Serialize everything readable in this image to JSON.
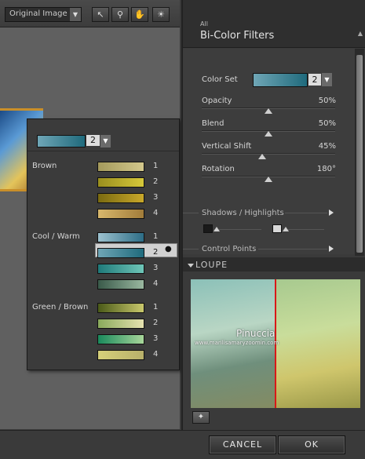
{
  "toolbar": {
    "view_mode": "Original Image",
    "tools": [
      "arrow-icon",
      "zoom-icon",
      "hand-icon",
      "light-icon"
    ]
  },
  "dropdown": {
    "selected_number": "2",
    "groups": [
      {
        "name": "Brown",
        "items": [
          {
            "n": "1",
            "colors": [
              "#a49a5c",
              "#d3c88c"
            ]
          },
          {
            "n": "2",
            "colors": [
              "#9a8f1e",
              "#d6c83a"
            ]
          },
          {
            "n": "3",
            "colors": [
              "#7a6a10",
              "#c9a82a"
            ]
          },
          {
            "n": "4",
            "colors": [
              "#d8b86c",
              "#a27c3a"
            ]
          }
        ]
      },
      {
        "name": "Cool / Warm",
        "items": [
          {
            "n": "1",
            "colors": [
              "#9cc2cf",
              "#2d6d86"
            ]
          },
          {
            "n": "2",
            "colors": [
              "#6fa6b6",
              "#1f6a7c"
            ]
          },
          {
            "n": "3",
            "colors": [
              "#1f7a7a",
              "#6fc6b8"
            ]
          },
          {
            "n": "4",
            "colors": [
              "#3a5a4a",
              "#9ab8a0"
            ]
          }
        ]
      },
      {
        "name": "Green / Brown",
        "items": [
          {
            "n": "1",
            "colors": [
              "#4a5a18",
              "#c9c86c"
            ]
          },
          {
            "n": "2",
            "colors": [
              "#8aaa5c",
              "#e6e2b0"
            ]
          },
          {
            "n": "3",
            "colors": [
              "#1a8a5c",
              "#a8d69a"
            ]
          },
          {
            "n": "4",
            "colors": [
              "#d6d07a",
              "#b8b06a"
            ]
          }
        ]
      }
    ]
  },
  "panel": {
    "category": "All",
    "title": "Bi-Color Filters",
    "color_set_label": "Color Set",
    "color_set_value": "2",
    "sliders": [
      {
        "label": "Opacity",
        "value": "50%",
        "level": 0.5
      },
      {
        "label": "Blend",
        "value": "50%",
        "level": 0.5
      },
      {
        "label": "Vertical Shift",
        "value": "45%",
        "level": 0.45
      },
      {
        "label": "Rotation",
        "value": "180°",
        "level": 0.5
      }
    ],
    "shadows_label": "Shadows / Highlights",
    "control_points_label": "Control Points"
  },
  "loupe": {
    "label": "LOUPE",
    "watermark1": "Pinuccia",
    "watermark2": "www.marilisamaryzoomin.com"
  },
  "buttons": {
    "cancel": "CANCEL",
    "ok": "OK"
  }
}
